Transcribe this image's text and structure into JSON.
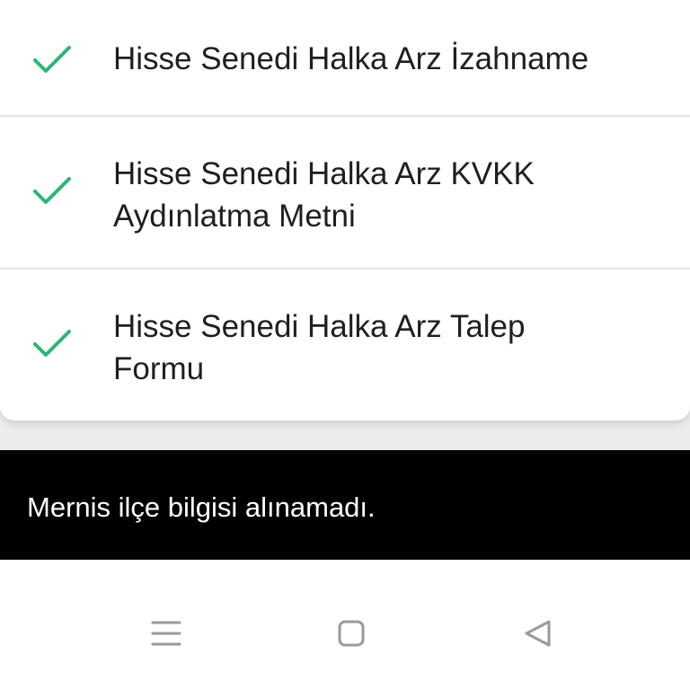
{
  "documents": [
    {
      "label": "Hisse Senedi Halka Arz İzahname",
      "icon": "checkmark-icon",
      "checked": true
    },
    {
      "label": "Hisse Senedi Halka Arz KVKK\nAydınlatma Metni",
      "icon": "checkmark-icon",
      "checked": true
    },
    {
      "label": "Hisse Senedi Halka Arz Talep\nFormu",
      "icon": "checkmark-icon",
      "checked": true
    }
  ],
  "toast": {
    "message": "Mernis ilçe bilgisi alınamadı."
  },
  "navbar": {
    "menu_icon": "menu-icon",
    "home_icon": "home-square-icon",
    "back_icon": "back-triangle-icon"
  },
  "colors": {
    "check": "#2bb673",
    "toast_bg": "#000000",
    "card_bg": "#ffffff",
    "nav_icon": "#9a9a9a"
  }
}
